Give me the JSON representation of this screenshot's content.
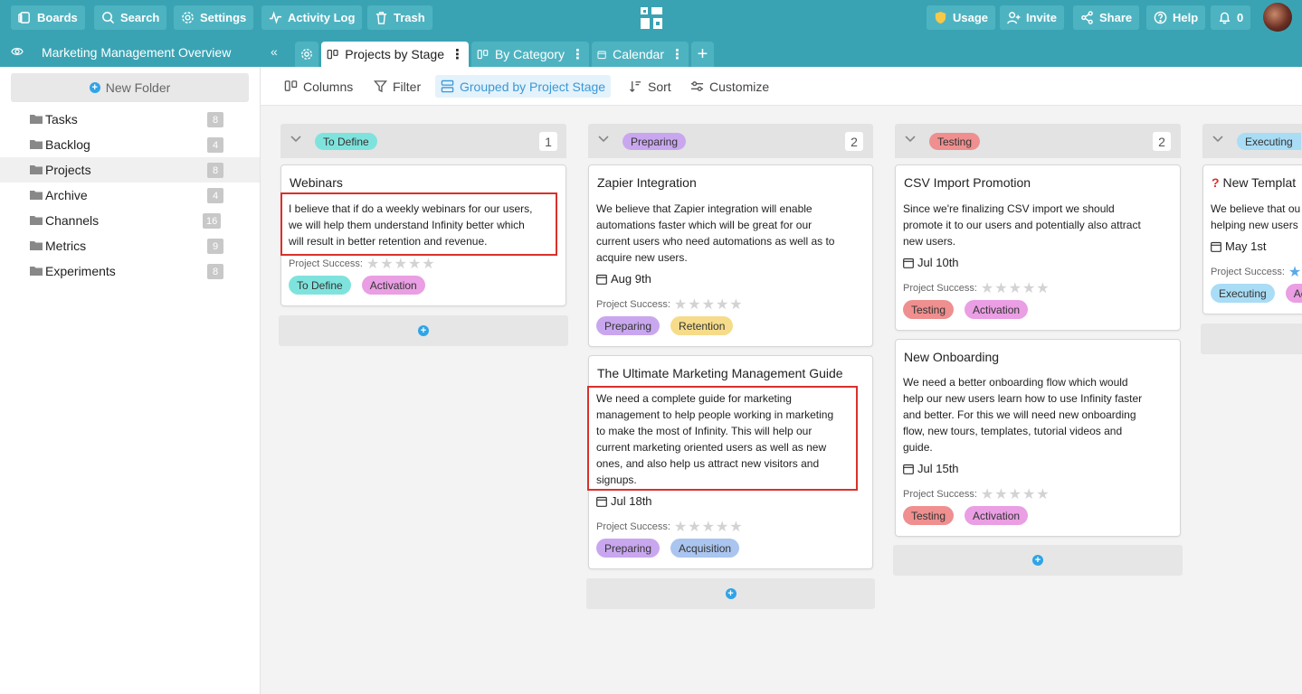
{
  "topbar": {
    "boards": "Boards",
    "search": "Search",
    "settings": "Settings",
    "activity_log": "Activity Log",
    "trash": "Trash",
    "usage": "Usage",
    "invite": "Invite",
    "share": "Share",
    "help": "Help",
    "notifications_count": "0"
  },
  "workspace": {
    "title": "Marketing Management Overview",
    "tabs": [
      {
        "label": "Projects by Stage"
      },
      {
        "label": "By Category"
      },
      {
        "label": "Calendar"
      }
    ],
    "more_glyph": "⋮",
    "add_tab_glyph": "+"
  },
  "sidebar": {
    "new_folder": "New Folder",
    "folders": [
      {
        "label": "Tasks",
        "count": "8"
      },
      {
        "label": "Backlog",
        "count": "4"
      },
      {
        "label": "Projects",
        "count": "8"
      },
      {
        "label": "Archive",
        "count": "4"
      },
      {
        "label": "Channels",
        "count": "16"
      },
      {
        "label": "Metrics",
        "count": "9"
      },
      {
        "label": "Experiments",
        "count": "8"
      }
    ]
  },
  "toolbar": {
    "columns": "Columns",
    "filter": "Filter",
    "grouped": "Grouped by Project Stage",
    "sort": "Sort",
    "customize": "Customize"
  },
  "colors": {
    "to_define": "#7fe3dd",
    "preparing": "#c9a7ef",
    "testing": "#ef8f8f",
    "executing": "#a9dcf5",
    "activation": "#ea9ee3",
    "retention": "#f6dc8a",
    "acquisition": "#aac5ef"
  },
  "board": {
    "success_label": "Project Success:",
    "stars_glyph": "★★★★★",
    "columns": [
      {
        "stage": "To Define",
        "count": "1",
        "cards": [
          {
            "title": "Webinars",
            "desc_lines": [
              "I believe that if do a weekly webinars for our users,",
              "we will help them understand Infinity better which",
              "will result in better retention and revenue."
            ],
            "tags": [
              "To Define",
              "Activation"
            ]
          }
        ]
      },
      {
        "stage": "Preparing",
        "count": "2",
        "cards": [
          {
            "title": "Zapier Integration",
            "desc_lines": [
              "We believe that Zapier integration will enable",
              "automations faster which will be great for our",
              "current users who need automations as well as to",
              "acquire new users."
            ],
            "date": "Aug 9th",
            "tags": [
              "Preparing",
              "Retention"
            ]
          },
          {
            "title": "The Ultimate Marketing Management Guide",
            "desc_lines": [
              "We need a complete guide for marketing",
              "management to help people working in marketing",
              "to make the most of Infinity. This will help our",
              "current marketing oriented users as well as new",
              "ones, and also help us attract new visitors and",
              "signups."
            ],
            "date": "Jul 18th",
            "tags": [
              "Preparing",
              "Acquisition"
            ]
          }
        ]
      },
      {
        "stage": "Testing",
        "count": "2",
        "cards": [
          {
            "title": "CSV Import Promotion",
            "desc_lines": [
              "Since we're finalizing CSV import we should",
              "promote it to our users and potentially also attract",
              "new users."
            ],
            "date": "Jul 10th",
            "tags": [
              "Testing",
              "Activation"
            ]
          },
          {
            "title": "New Onboarding",
            "desc_lines": [
              "We need a better onboarding flow which would",
              "help our new users learn how to use Infinity faster",
              "and better. For this we will need new onboarding",
              "flow, new tours, templates, tutorial videos and",
              "guide."
            ],
            "date": "Jul 15th",
            "tags": [
              "Testing",
              "Activation"
            ]
          }
        ]
      },
      {
        "stage": "Executing",
        "cards": [
          {
            "title": "New Templat",
            "desc_lines": [
              "We believe that ou",
              "helping new users"
            ],
            "date": "May 1st",
            "tags": [
              "Executing",
              "Ac"
            ]
          }
        ]
      }
    ]
  }
}
